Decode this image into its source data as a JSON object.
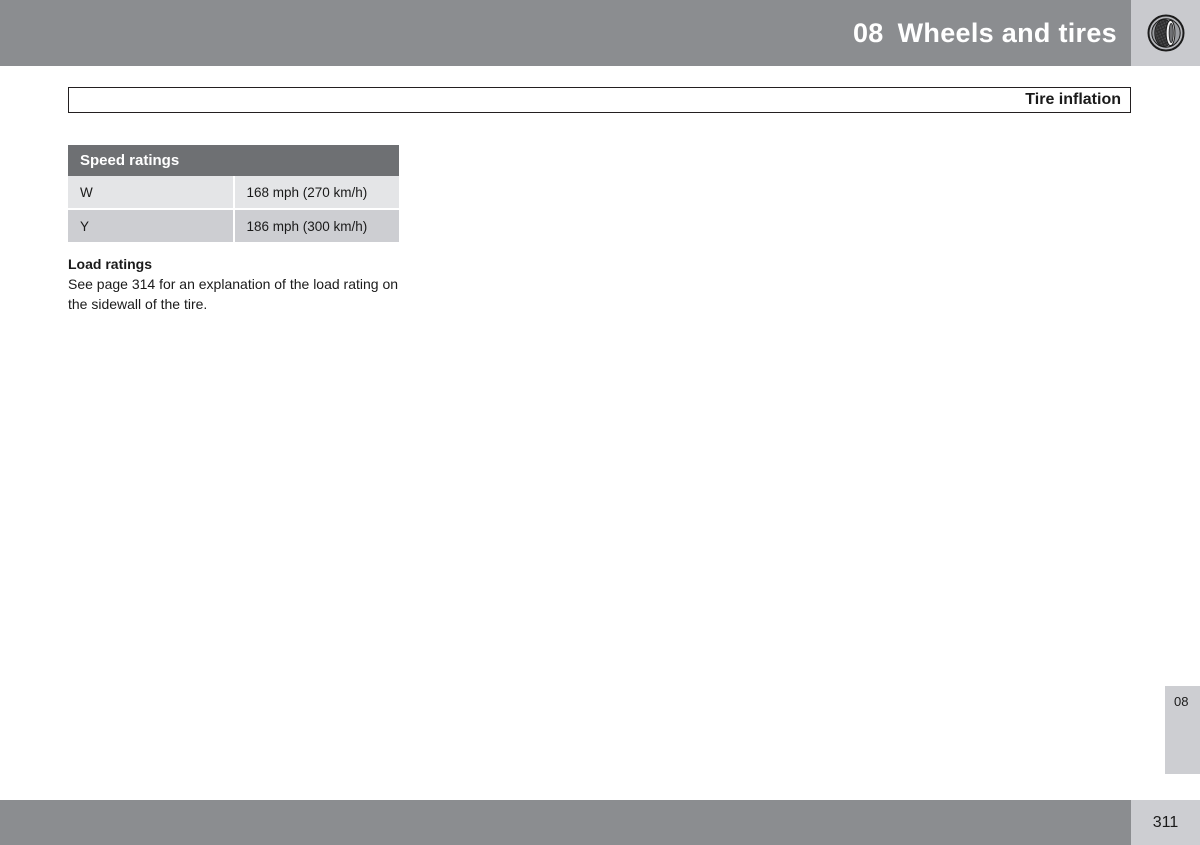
{
  "header": {
    "chapter_number": "08",
    "chapter_title": "Wheels and tires",
    "icon": "tire-icon",
    "bar_color": "#8b8d90",
    "icon_box_color": "#c9cace",
    "text_color": "#ffffff"
  },
  "section": {
    "title": "Tire inflation",
    "border_color": "#231f20"
  },
  "table": {
    "name": "speed-ratings-table",
    "header_label": "Speed ratings",
    "header_bg": "#6e7073",
    "row_bg_odd": "#e4e5e7",
    "row_bg_even": "#cdced2",
    "rows": [
      {
        "code": "W",
        "speed": "168 mph (270 km/h)"
      },
      {
        "code": "Y",
        "speed": "186 mph (300 km/h)"
      }
    ]
  },
  "content": {
    "subheading": "Load ratings",
    "paragraph": "See page 314 for an explanation of the load rating on the sidewall of the tire."
  },
  "chapter_tab": {
    "label": "08",
    "bg_color": "#cdced2"
  },
  "footer": {
    "page_number": "311",
    "bar_color": "#8b8d90",
    "page_area_color": "#cdced2"
  }
}
